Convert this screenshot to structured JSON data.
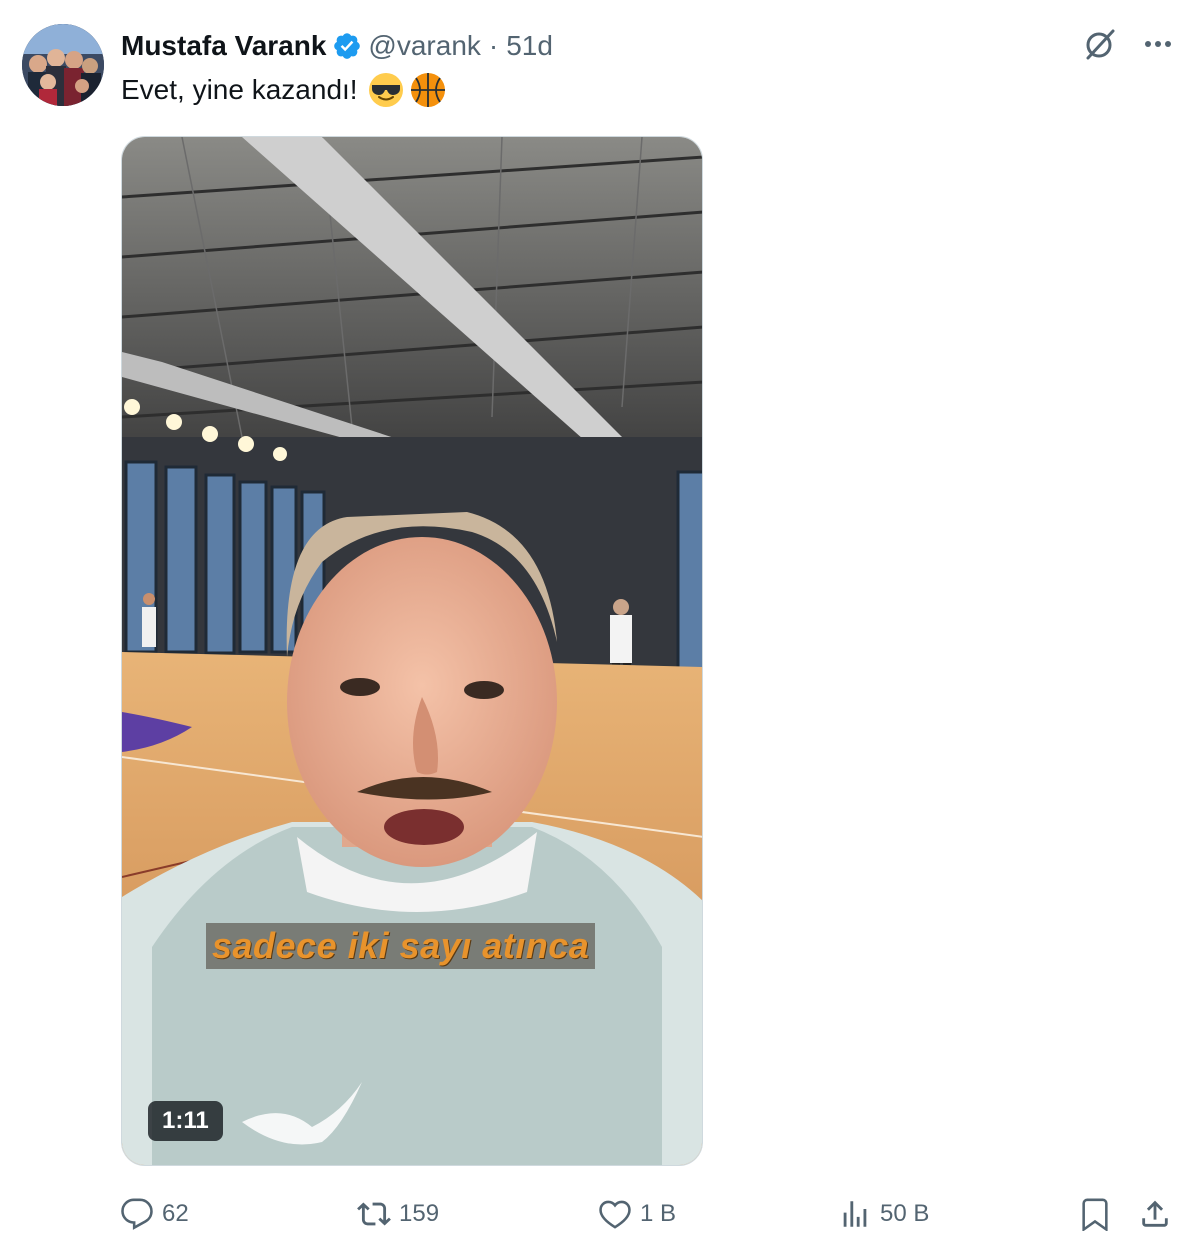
{
  "tweet": {
    "author_name": "Mustafa Varank",
    "handle": "@varank",
    "separator": "·",
    "time": "51d",
    "text": "Evet, yine kazandı!",
    "emojis": [
      "sunglasses-emoji",
      "basketball-emoji"
    ]
  },
  "media": {
    "subtitle": "sadece iki sayı atınca",
    "duration": "1:11"
  },
  "actions": {
    "replies": "62",
    "reposts": "159",
    "likes": "1 B",
    "views": "50 B"
  },
  "colors": {
    "verified": "#1d9bf0",
    "secondary_text": "#536471",
    "subtitle": "#e8932c"
  }
}
